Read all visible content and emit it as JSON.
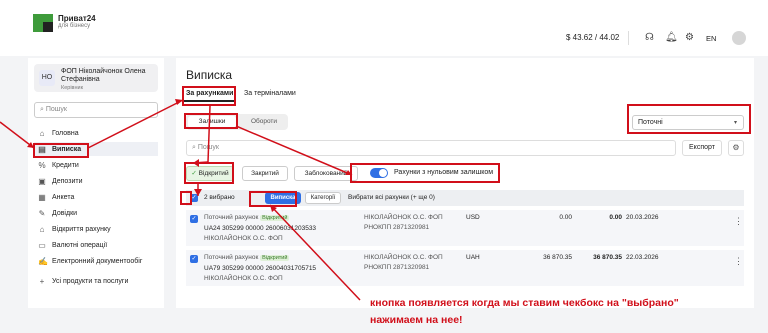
{
  "header": {
    "brand_name": "Приват24",
    "brand_sub": "для бізнесу",
    "balance": "$ 43.62 / 44.02",
    "lang": "EN",
    "icons": [
      "headphones-icon",
      "bell-icon",
      "gear-icon",
      "avatar"
    ]
  },
  "sidebar": {
    "org_initials": "НО",
    "org_name": "ФОП Ніколайчонок Олена Стефанівна",
    "org_role": "Керівник",
    "search_placeholder": "Пошук",
    "items": [
      {
        "label": "Головна",
        "icon": "home-icon"
      },
      {
        "label": "Виписка",
        "icon": "document-icon",
        "active": true
      },
      {
        "label": "Кредити",
        "icon": "percent-icon"
      },
      {
        "label": "Депозити",
        "icon": "deposit-icon"
      },
      {
        "label": "Анкета",
        "icon": "form-icon"
      },
      {
        "label": "Довідки",
        "icon": "certificate-icon"
      },
      {
        "label": "Відкриття рахунку",
        "icon": "bank-icon"
      },
      {
        "label": "Валютні операції",
        "icon": "currency-icon"
      },
      {
        "label": "Електронний документообіг",
        "icon": "edoc-icon"
      },
      {
        "label": "Усі продукти та послуги",
        "icon": "plus-icon"
      }
    ]
  },
  "main": {
    "title": "Виписка",
    "tabs": [
      "За рахунками",
      "За терміналами"
    ],
    "segment": [
      "Залишки",
      "Обороти"
    ],
    "select_value": "Поточні",
    "search_placeholder": "Пошук",
    "export_label": "Експорт",
    "filters": [
      "Відкритий",
      "Закритий",
      "Заблокований"
    ],
    "zero_balance_label": "Рахунки з нульовим залишком",
    "table_header": {
      "selected": "2 вибрано",
      "statement_btn": "Виписка",
      "categories_btn": "Категорії",
      "select_all": "Вибрати всі рахунки (+ ще 0)"
    },
    "rows": [
      {
        "type": "Поточний рахунок",
        "status": "Відкритий",
        "iban": "UA24 305299 00000 26006031203533",
        "owner": "НІКОЛАЙОНОК О.С. ФОП",
        "holder": "НІКОЛАЙОНОК О.С. ФОП",
        "tax_id": "РНОКПП 2871320981",
        "currency": "USD",
        "amount": "0.00",
        "amount_bold": "0.00",
        "date": "20.03.2026"
      },
      {
        "type": "Поточний рахунок",
        "status": "Відкритий",
        "iban": "UA79 305299 00000 26004031705715",
        "owner": "НІКОЛАЙОНОК О.С. ФОП",
        "holder": "НІКОЛАЙОНОК О.С. ФОП",
        "tax_id": "РНОКПП 2871320981",
        "currency": "UAH",
        "amount": "36 870.35",
        "amount_bold": "36 870.35",
        "date": "22.03.2026"
      }
    ]
  },
  "annotation": {
    "line1": "кнопка появляется когда мы ставим чекбокс на \"выбрано\"",
    "line2": "нажимаем на нее!",
    "color": "#d10f1a"
  }
}
